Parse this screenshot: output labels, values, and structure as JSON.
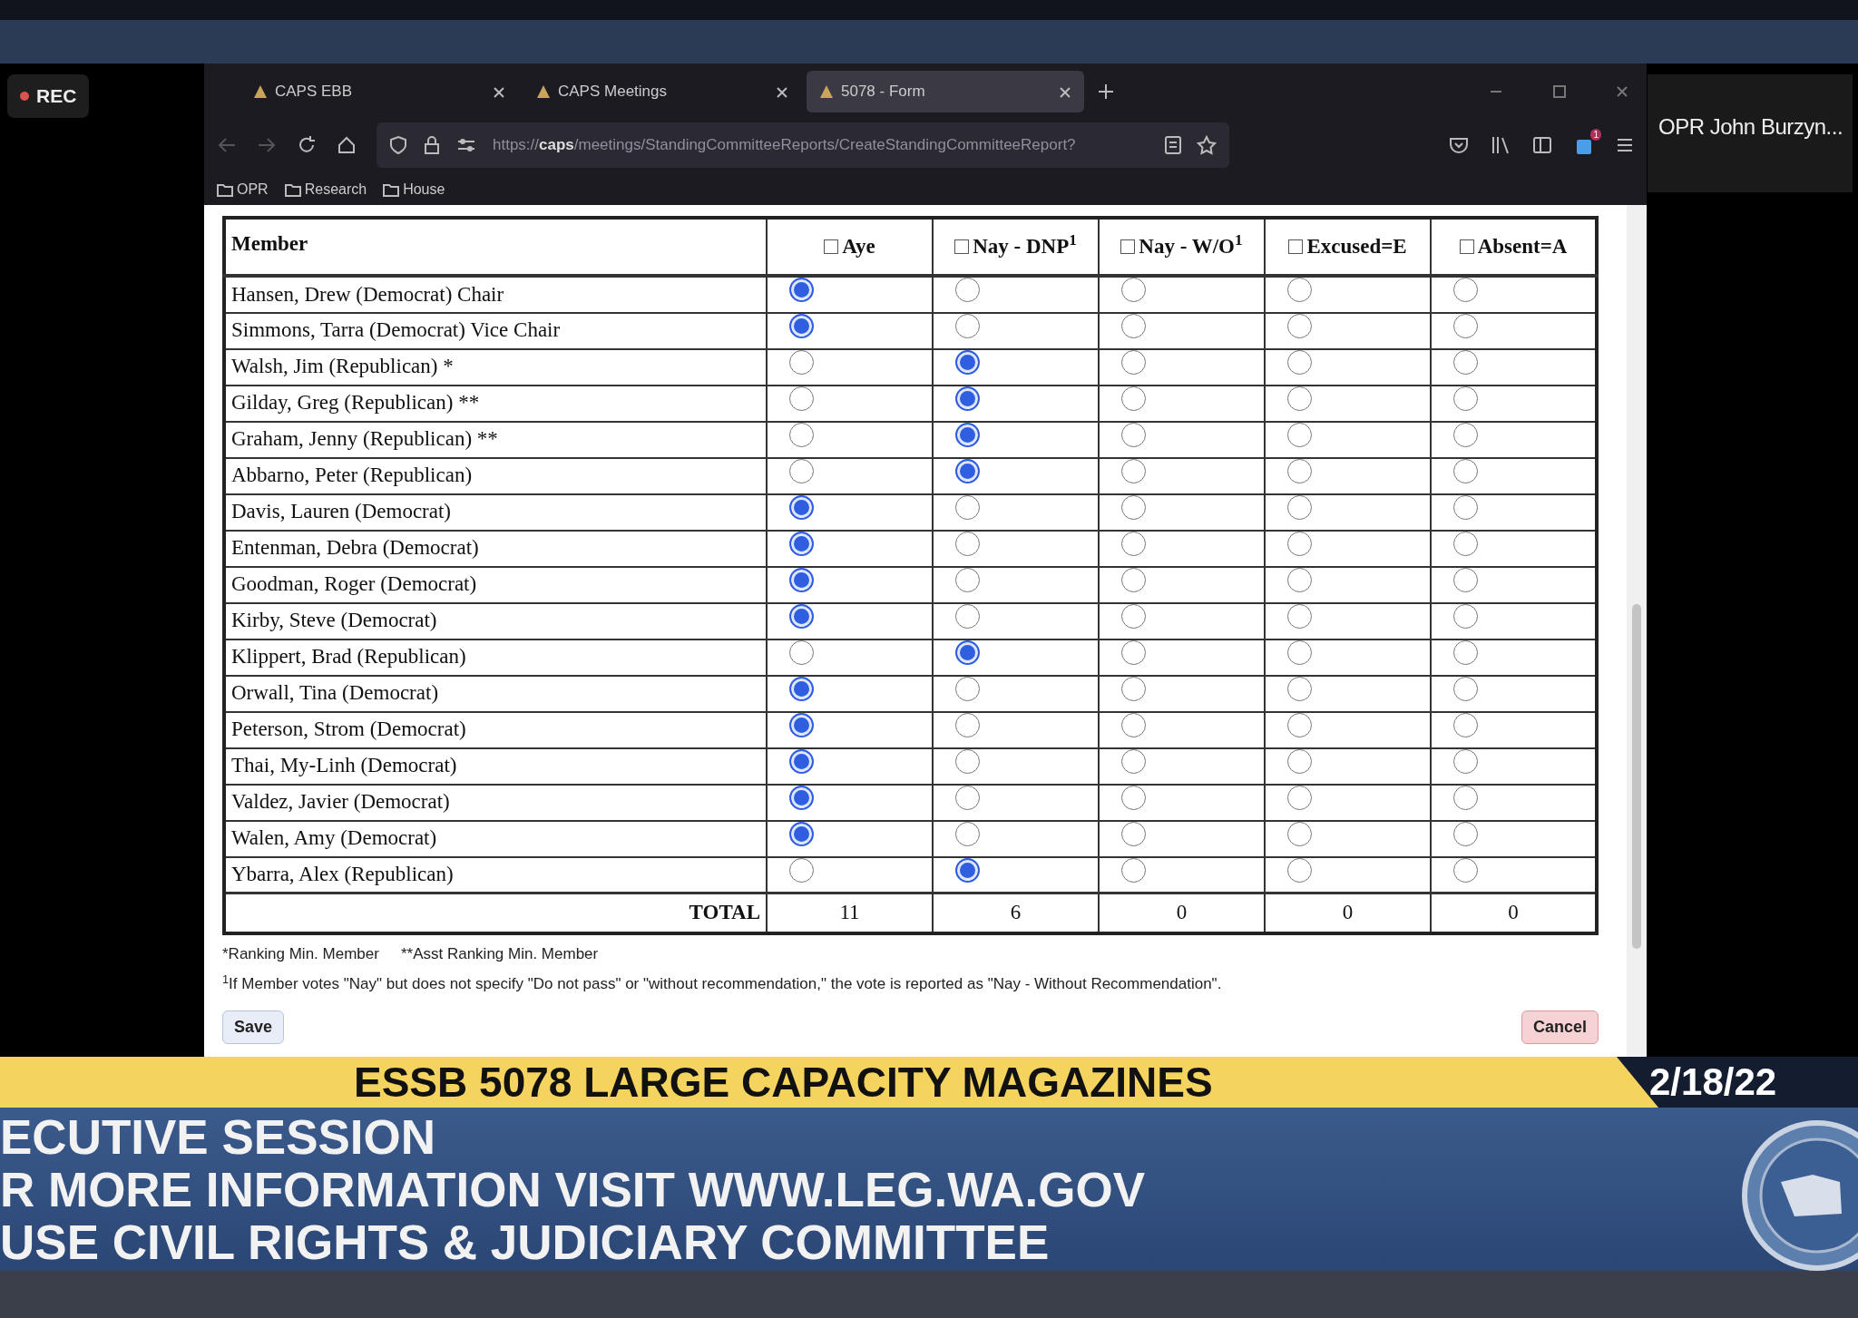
{
  "recording": {
    "label": "REC"
  },
  "participant": {
    "name": "OPR John Burzyn..."
  },
  "browser": {
    "tabs": [
      {
        "title": "CAPS EBB",
        "selected": false
      },
      {
        "title": "CAPS Meetings",
        "selected": false
      },
      {
        "title": "5078 - Form",
        "selected": true
      }
    ],
    "url": "https://**caps**/meetings/StandingCommitteeReports/CreateStandingCommitteeReport?",
    "extension_badge": "1",
    "bookmarks": [
      "OPR",
      "Research",
      "House"
    ]
  },
  "form": {
    "columns": [
      {
        "label": "Member"
      },
      {
        "label": "Aye",
        "checked": false
      },
      {
        "label": "Nay - DNP$^{1}$",
        "checked": false
      },
      {
        "label": "Nay - W/O$^{1}$",
        "checked": false
      },
      {
        "label": "Excused=E",
        "checked": false
      },
      {
        "label": "Absent=A",
        "checked": false
      }
    ],
    "rows": [
      {
        "member": "Hansen, Drew (Democrat) Chair",
        "options": [
          {
            "selected": true
          },
          {
            "selected": false
          },
          {
            "selected": false
          },
          {
            "selected": false
          },
          {
            "selected": false
          }
        ]
      },
      {
        "member": "Simmons, Tarra (Democrat) Vice Chair",
        "options": [
          {
            "selected": true
          },
          {
            "selected": false
          },
          {
            "selected": false
          },
          {
            "selected": false
          },
          {
            "selected": false
          }
        ]
      },
      {
        "member": "Walsh, Jim (Republican) *",
        "options": [
          {
            "selected": false
          },
          {
            "selected": true
          },
          {
            "selected": false
          },
          {
            "selected": false
          },
          {
            "selected": false
          }
        ]
      },
      {
        "member": "Gilday, Greg (Republican) **",
        "options": [
          {
            "selected": false
          },
          {
            "selected": true
          },
          {
            "selected": false
          },
          {
            "selected": false
          },
          {
            "selected": false
          }
        ]
      },
      {
        "member": "Graham, Jenny (Republican) **",
        "options": [
          {
            "selected": false
          },
          {
            "selected": true
          },
          {
            "selected": false
          },
          {
            "selected": false
          },
          {
            "selected": false
          }
        ]
      },
      {
        "member": "Abbarno, Peter (Republican)",
        "options": [
          {
            "selected": false
          },
          {
            "selected": true
          },
          {
            "selected": false
          },
          {
            "selected": false
          },
          {
            "selected": false
          }
        ]
      },
      {
        "member": "Davis, Lauren (Democrat)",
        "options": [
          {
            "selected": true
          },
          {
            "selected": false
          },
          {
            "selected": false
          },
          {
            "selected": false
          },
          {
            "selected": false
          }
        ]
      },
      {
        "member": "Entenman, Debra (Democrat)",
        "options": [
          {
            "selected": true
          },
          {
            "selected": false
          },
          {
            "selected": false
          },
          {
            "selected": false
          },
          {
            "selected": false
          }
        ]
      },
      {
        "member": "Goodman, Roger (Democrat)",
        "options": [
          {
            "selected": true
          },
          {
            "selected": false
          },
          {
            "selected": false
          },
          {
            "selected": false
          },
          {
            "selected": false
          }
        ]
      },
      {
        "member": "Kirby, Steve (Democrat)",
        "options": [
          {
            "selected": true
          },
          {
            "selected": false
          },
          {
            "selected": false
          },
          {
            "selected": false
          },
          {
            "selected": false
          }
        ]
      },
      {
        "member": "Klippert, Brad (Republican)",
        "options": [
          {
            "selected": false
          },
          {
            "selected": true
          },
          {
            "selected": false
          },
          {
            "selected": false
          },
          {
            "selected": false
          }
        ]
      },
      {
        "member": "Orwall, Tina (Democrat)",
        "options": [
          {
            "selected": true
          },
          {
            "selected": false
          },
          {
            "selected": false
          },
          {
            "selected": false
          },
          {
            "selected": false
          }
        ]
      },
      {
        "member": "Peterson, Strom (Democrat)",
        "options": [
          {
            "selected": true
          },
          {
            "selected": false
          },
          {
            "selected": false
          },
          {
            "selected": false
          },
          {
            "selected": false
          }
        ]
      },
      {
        "member": "Thai, My-Linh (Democrat)",
        "options": [
          {
            "selected": true
          },
          {
            "selected": false
          },
          {
            "selected": false
          },
          {
            "selected": false
          },
          {
            "selected": false
          }
        ]
      },
      {
        "member": "Valdez, Javier (Democrat)",
        "options": [
          {
            "selected": true
          },
          {
            "selected": false
          },
          {
            "selected": false
          },
          {
            "selected": false
          },
          {
            "selected": false
          }
        ]
      },
      {
        "member": "Walen, Amy (Democrat)",
        "options": [
          {
            "selected": true
          },
          {
            "selected": false
          },
          {
            "selected": false
          },
          {
            "selected": false
          },
          {
            "selected": false
          }
        ]
      },
      {
        "member": "Ybarra, Alex (Republican)",
        "options": [
          {
            "selected": false
          },
          {
            "selected": true
          },
          {
            "selected": false
          },
          {
            "selected": false
          },
          {
            "selected": false
          }
        ]
      }
    ],
    "total": {
      "label": "TOTAL",
      "values": [
        "11",
        "6",
        "0",
        "0",
        "0"
      ]
    },
    "notes": [
      "*Ranking Min. Member",
      "**Asst Ranking Min. Member"
    ],
    "footnote": "$^{1}$If Member votes \"Nay\" but does not specify \"Do not pass\" or \"without recommendation,\" the vote is reported as \"Nay - Without Recommendation\".",
    "buttons": {
      "save": "Save",
      "cancel": "Cancel"
    }
  },
  "banner": {
    "title": "ESSB 5078  LARGE CAPACITY MAGAZINES",
    "date": "2/18/22",
    "lines": [
      "ECUTIVE SESSION",
      "R MORE INFORMATION VISIT WWW.LEG.WA.GOV",
      "USE CIVIL RIGHTS & JUDICIARY COMMITTEE"
    ]
  }
}
